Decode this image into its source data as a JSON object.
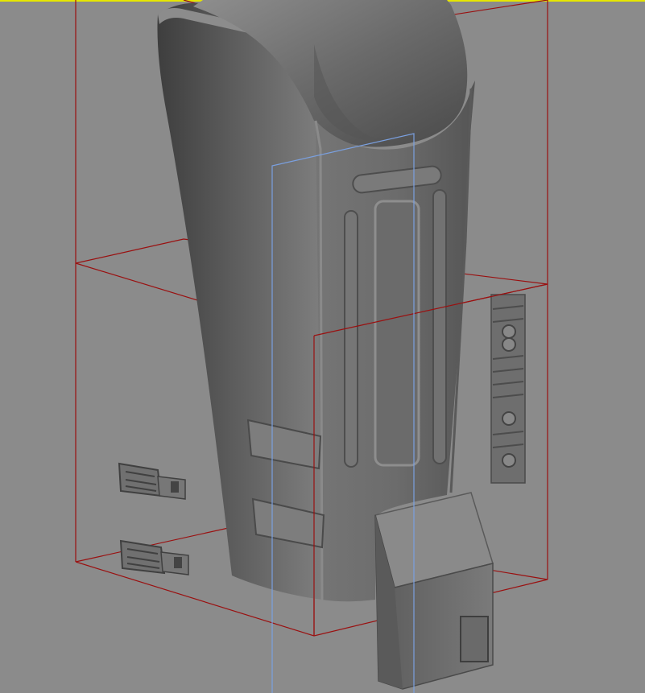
{
  "viewport": {
    "background": "#8b8b8b",
    "active_border_color": "#e6e600",
    "bounds_color": "#9a1010",
    "gizmo_color": "#7aa0e0"
  },
  "objects": [
    {
      "name": "gauntlet-shell",
      "color": "#6d6d6d",
      "selected": true
    },
    {
      "name": "gauntlet-panel",
      "color": "#777777",
      "selected": false
    },
    {
      "name": "cable-clip",
      "color": "#6a6a6a",
      "selected": false
    },
    {
      "name": "rivet-strip",
      "color": "#707070",
      "selected": false
    }
  ]
}
